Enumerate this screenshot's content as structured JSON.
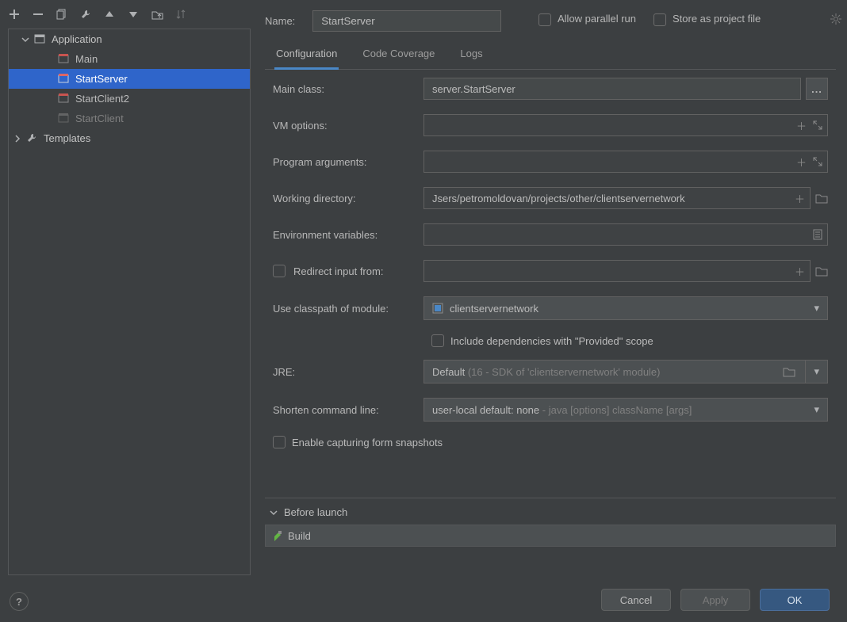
{
  "toolbar_icons": [
    "add",
    "remove",
    "copy",
    "wrench",
    "move-up",
    "move-down",
    "folder",
    "sort"
  ],
  "tree": {
    "root": "Application",
    "items": [
      {
        "label": "Main",
        "dim": false
      },
      {
        "label": "StartServer",
        "dim": false,
        "selected": true
      },
      {
        "label": "StartClient2",
        "dim": false
      },
      {
        "label": "StartClient",
        "dim": true
      }
    ],
    "second_root": "Templates"
  },
  "name": {
    "label": "Name:",
    "value": "StartServer"
  },
  "checks": {
    "parallel": "Allow parallel run",
    "store": "Store as project file"
  },
  "tabs": [
    "Configuration",
    "Code Coverage",
    "Logs"
  ],
  "form": {
    "main_class": {
      "label": "Main class:",
      "value": "server.StartServer"
    },
    "vm": {
      "label": "VM options:",
      "value": ""
    },
    "args": {
      "label": "Program arguments:",
      "value": ""
    },
    "wd": {
      "label": "Working directory:",
      "value": "Jsers/petromoldovan/projects/other/clientservernetwork"
    },
    "env": {
      "label": "Environment variables:",
      "value": ""
    },
    "redirect": {
      "label": "Redirect input from:"
    },
    "classpath": {
      "label": "Use classpath of module:",
      "value": "clientservernetwork"
    },
    "include_provided": "Include dependencies with \"Provided\" scope",
    "jre": {
      "label": "JRE:",
      "value": "Default",
      "hint": "(16 - SDK of 'clientservernetwork' module)"
    },
    "shorten": {
      "label": "Shorten command line:",
      "value": "user-local default: none",
      "hint": "- java [options] className [args]"
    },
    "snapshots": "Enable capturing form snapshots"
  },
  "before_launch": {
    "title": "Before launch",
    "items": [
      "Build"
    ]
  },
  "buttons": {
    "cancel": "Cancel",
    "apply": "Apply",
    "ok": "OK"
  }
}
